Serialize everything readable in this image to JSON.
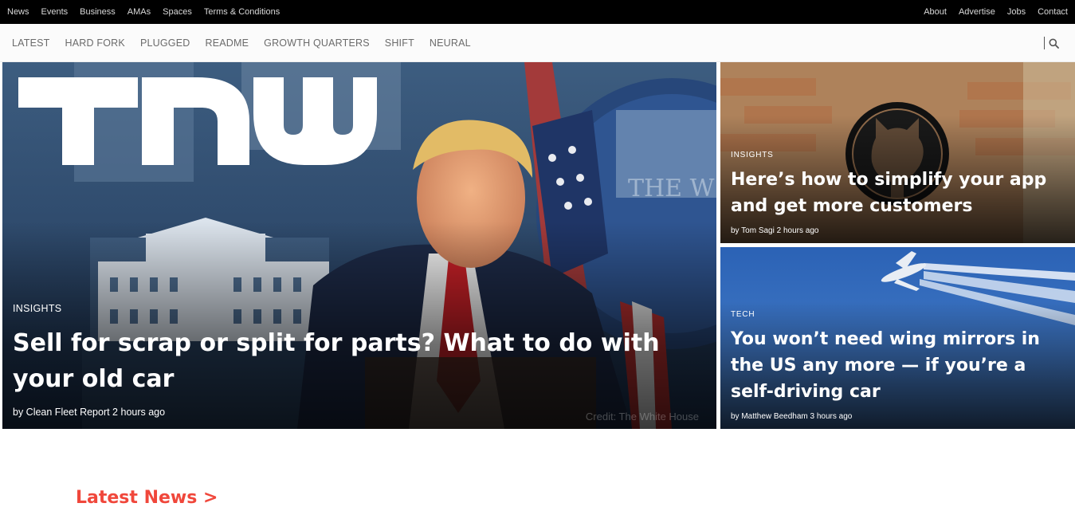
{
  "topbar": {
    "left_links": [
      "News",
      "Events",
      "Business",
      "AMAs",
      "Spaces",
      "Terms & Conditions"
    ],
    "right_links": [
      "About",
      "Advertise",
      "Jobs",
      "Contact"
    ]
  },
  "section_nav": {
    "items": [
      "LATEST",
      "HARD FORK",
      "PLUGGED",
      "README",
      "GROWTH QUARTERS",
      "SHIFT",
      "NEURAL"
    ]
  },
  "logo": {
    "text": "TNW"
  },
  "hero": {
    "category": "INSIGHTS",
    "headline": "Sell for scrap or split for parts? What to do with your old car",
    "byline": "by Clean Fleet Report 2 hours ago",
    "photo_credit": "Credit: The White House"
  },
  "side_stories": [
    {
      "category": "INSIGHTS",
      "headline": "Here’s how to simplify your app and get more customers",
      "byline": "by Tom Sagi 2 hours ago"
    },
    {
      "category": "TECH",
      "headline": "You won’t need wing mirrors in the US any more — if you’re a self-driving car",
      "byline": "by Matthew Beedham 3 hours ago"
    }
  ],
  "latest_news": {
    "label": "Latest News >"
  },
  "colors": {
    "accent": "#f0473b",
    "topbar": "#000000"
  }
}
